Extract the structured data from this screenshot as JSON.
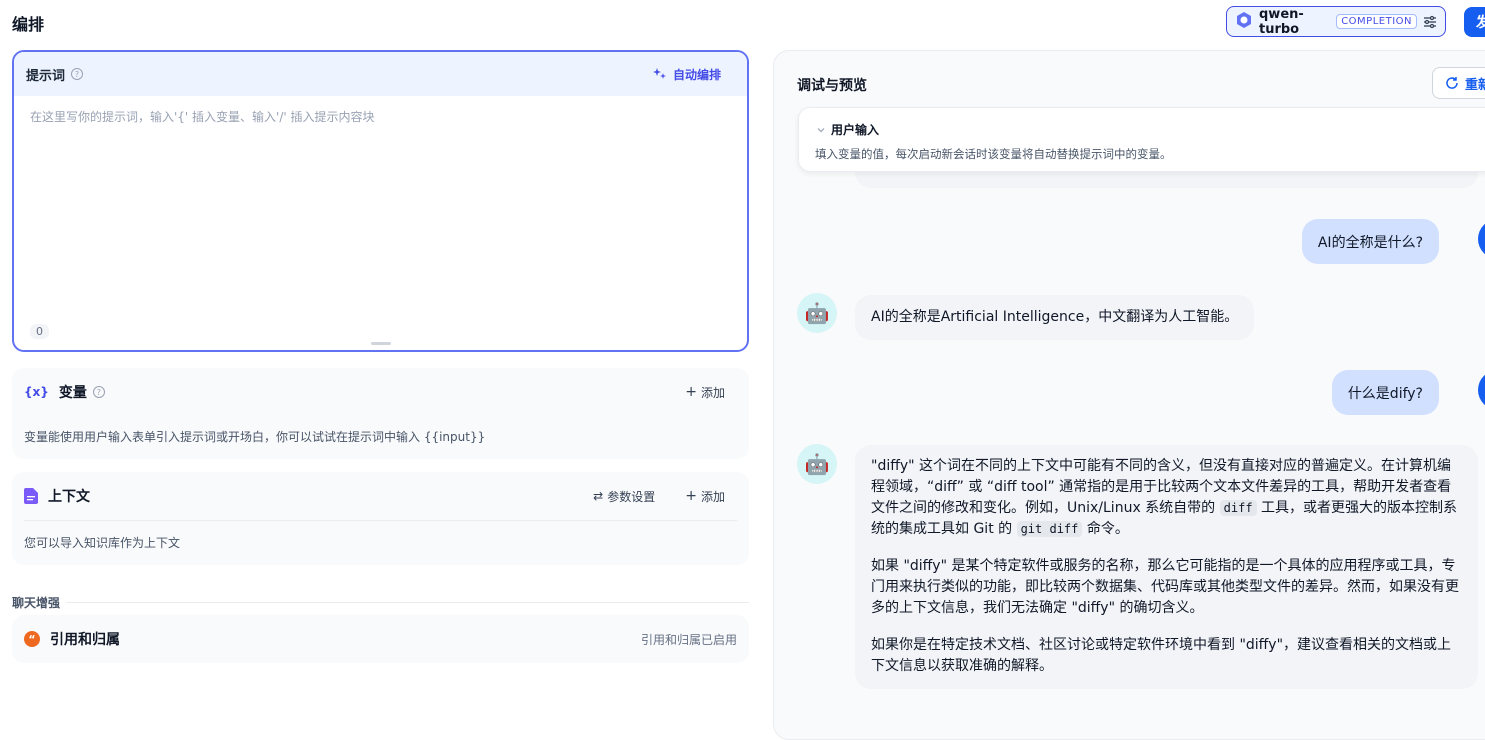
{
  "header": {
    "title": "编排",
    "model": {
      "name": "qwen-turbo",
      "mode": "COMPLETION"
    },
    "publish_label": "发"
  },
  "prompt": {
    "title": "提示词",
    "auto_label": "自动编排",
    "placeholder": "在这里写你的提示词，输入'{' 插入变量、输入'/' 插入提示内容块",
    "value": "",
    "char_count": "0"
  },
  "variables": {
    "title": "变量",
    "add_label": "添加",
    "description": "变量能使用用户输入表单引入提示词或开场白，你可以试试在提示词中输入 {{input}}"
  },
  "context": {
    "title": "上下文",
    "settings_label": "参数设置",
    "add_label": "添加",
    "description": "您可以导入知识库作为上下文"
  },
  "chat_enhance": {
    "section_label": "聊天增强",
    "citation_title": "引用和归属",
    "citation_status": "引用和归属已启用"
  },
  "debug": {
    "title": "调试与预览",
    "restart_label": "重新",
    "user_input": {
      "title": "用户输入",
      "description": "填入变量的值，每次启动新会话时该变量将自动替换提示词中的变量。"
    },
    "messages": [
      {
        "role": "user",
        "text": "AI的全称是什么?"
      },
      {
        "role": "assistant",
        "text": "AI的全称是Artificial Intelligence，中文翻译为人工智能。"
      },
      {
        "role": "user",
        "text": "什么是dify?"
      },
      {
        "role": "assistant",
        "p1_a": "\"diffy\" 这个词在不同的上下文中可能有不同的含义，但没有直接对应的普遍定义。在计算机编程领域，“diff” 或 “diff tool” 通常指的是用于比较两个文本文件差异的工具，帮助开发者查看文件之间的修改和变化。例如，Unix/Linux 系统自带的 ",
        "p1_code1": "diff",
        "p1_b": " 工具，或者更强大的版本控制系统的集成工具如 Git 的 ",
        "p1_code2": "git diff",
        "p1_c": " 命令。",
        "p2": "如果 \"diffy\" 是某个特定软件或服务的名称，那么它可能指的是一个具体的应用程序或工具，专门用来执行类似的功能，即比较两个数据集、代码库或其他类型文件的差异。然而，如果没有更多的上下文信息，我们无法确定 \"diffy\" 的确切含义。",
        "p3": "如果你是在特定技术文档、社区讨论或特定软件环境中看到 \"diffy\"，建议查看相关的文档或上下文信息以获取准确的解释。"
      }
    ]
  },
  "colors": {
    "accent": "#155eef",
    "brand": "#444ce7",
    "prompt_border": "#6172f3"
  }
}
